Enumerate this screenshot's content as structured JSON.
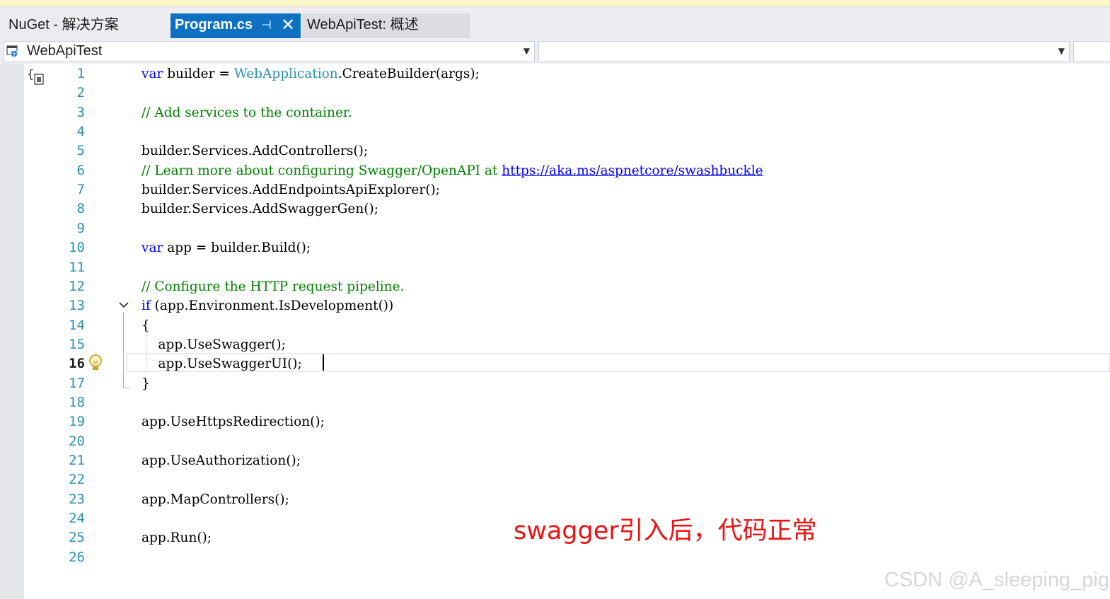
{
  "tabs": [
    {
      "label": "NuGet - 解决方案",
      "active": false
    },
    {
      "label": "Program.cs",
      "active": true,
      "pin_icon": "pin-icon",
      "close_icon": "close-icon"
    },
    {
      "label": "WebApiTest: 概述",
      "active": false
    }
  ],
  "tab_pin_glyph": "⊣",
  "tab_close_glyph": "✕",
  "navigation": {
    "project_selector": "WebApiTest",
    "type_selector": "",
    "member_selector": ""
  },
  "editor": {
    "current_line": 16,
    "lines": [
      {
        "n": "1",
        "text": "var builder = WebApplication.CreateBuilder(args);"
      },
      {
        "n": "2",
        "text": ""
      },
      {
        "n": "3",
        "text": "// Add services to the container."
      },
      {
        "n": "4",
        "text": ""
      },
      {
        "n": "5",
        "text": "builder.Services.AddControllers();"
      },
      {
        "n": "6",
        "text": "// Learn more about configuring Swagger/OpenAPI at https://aka.ms/aspnetcore/swashbuckle"
      },
      {
        "n": "7",
        "text": "builder.Services.AddEndpointsApiExplorer();"
      },
      {
        "n": "8",
        "text": "builder.Services.AddSwaggerGen();"
      },
      {
        "n": "9",
        "text": ""
      },
      {
        "n": "10",
        "text": "var app = builder.Build();"
      },
      {
        "n": "11",
        "text": ""
      },
      {
        "n": "12",
        "text": "// Configure the HTTP request pipeline."
      },
      {
        "n": "13",
        "text": "if (app.Environment.IsDevelopment())"
      },
      {
        "n": "14",
        "text": "{"
      },
      {
        "n": "15",
        "text": "    app.UseSwagger();"
      },
      {
        "n": "16",
        "text": "    app.UseSwaggerUI();"
      },
      {
        "n": "17",
        "text": "}"
      },
      {
        "n": "18",
        "text": ""
      },
      {
        "n": "19",
        "text": "app.UseHttpsRedirection();"
      },
      {
        "n": "20",
        "text": ""
      },
      {
        "n": "21",
        "text": "app.UseAuthorization();"
      },
      {
        "n": "22",
        "text": ""
      },
      {
        "n": "23",
        "text": "app.MapControllers();"
      },
      {
        "n": "24",
        "text": ""
      },
      {
        "n": "25",
        "text": "app.Run();"
      },
      {
        "n": "26",
        "text": ""
      }
    ]
  },
  "annotation": "swagger引入后，代码正常",
  "watermark": "CSDN @A_sleeping_pig",
  "colors": {
    "keyword": "#0000ff",
    "comment": "#008000",
    "type": "#2b91af",
    "line_number": "#2b91af",
    "active_tab": "#0e70c0",
    "annotation": "#ee1111"
  }
}
